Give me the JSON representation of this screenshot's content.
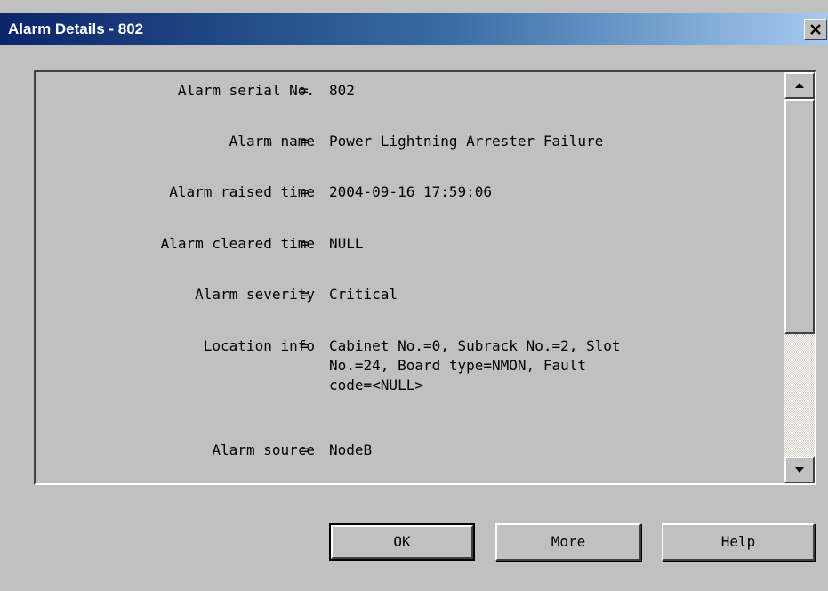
{
  "window": {
    "title": "Alarm Details - 802"
  },
  "details": {
    "rows": [
      {
        "label": "Alarm serial No.",
        "separator": "=",
        "value": "802"
      },
      {
        "label": "Alarm name",
        "separator": "=",
        "value": "Power Lightning Arrester Failure"
      },
      {
        "label": "Alarm raised time",
        "separator": "=",
        "value": "2004-09-16 17:59:06"
      },
      {
        "label": "Alarm cleared time",
        "separator": "=",
        "value": "NULL"
      },
      {
        "label": "Alarm severity",
        "separator": "=",
        "value": "Critical"
      },
      {
        "label": "Location info",
        "separator": "=",
        "value": "Cabinet No.=0, Subrack No.=2, Slot\nNo.=24, Board type=NMON, Fault\ncode=<NULL>"
      },
      {
        "label": "Alarm source",
        "separator": "=",
        "value": "NodeB"
      }
    ]
  },
  "buttons": {
    "ok": "OK",
    "more": "More",
    "help": "Help"
  },
  "icons": {
    "close": "close-icon",
    "scroll_up": "arrow-up-icon",
    "scroll_down": "arrow-down-icon"
  }
}
